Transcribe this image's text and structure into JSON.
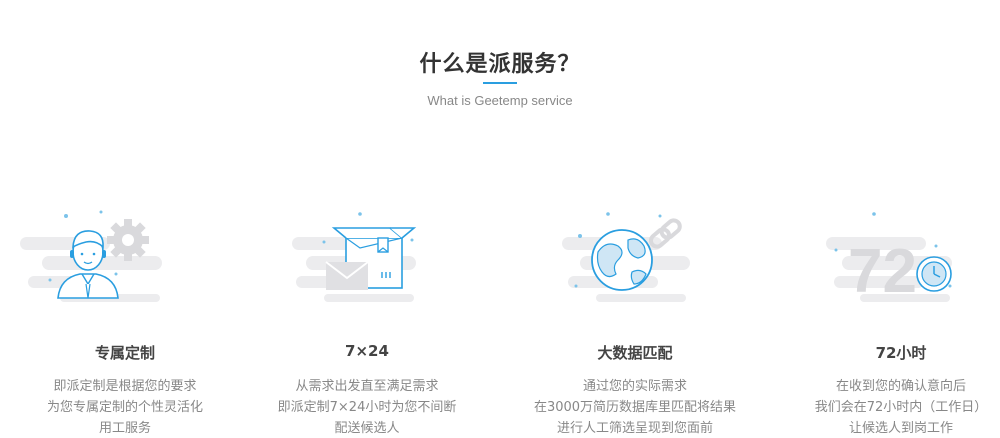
{
  "section": {
    "title": "什么是派服务？",
    "subtitle": "What is Geetemp service"
  },
  "colors": {
    "accent": "#2a9ee0",
    "title": "#333333",
    "text_gray": "#888888",
    "illus_gray": "#e6e6e8"
  },
  "features": [
    {
      "icon": "customer-service-person-icon",
      "title": "专属定制",
      "lines": [
        "即派定制是根据您的要求",
        "为您专属定制的个性灵活化",
        "用工服务"
      ]
    },
    {
      "icon": "open-box-mail-icon",
      "title": "7×24",
      "lines": [
        "从需求出发直至满足需求",
        "即派定制7×24小时为您不间断",
        "配送候选人"
      ]
    },
    {
      "icon": "globe-link-icon",
      "title": "大数据匹配",
      "lines": [
        "通过您的实际需求",
        "在3000万简历数据库里匹配将结果",
        "进行人工筛选呈现到您面前"
      ]
    },
    {
      "icon": "72-hours-clock-icon",
      "title": "72小时",
      "big_number": "72",
      "lines": [
        "在收到您的确认意向后",
        "我们会在72小时内（工作日）",
        "让候选人到岗工作"
      ]
    }
  ]
}
